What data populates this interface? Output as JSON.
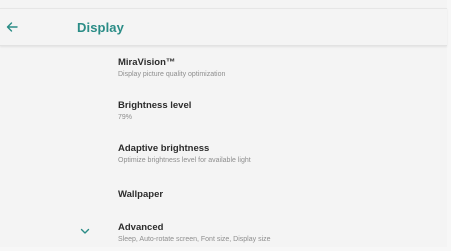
{
  "header": {
    "title": "Display",
    "back_icon": "arrow-left-icon"
  },
  "accent_color": "#2a8c86",
  "settings": [
    {
      "title": "MiraVision™",
      "summary": "Display picture quality optimization"
    },
    {
      "title": "Brightness level",
      "summary": "79%"
    },
    {
      "title": "Adaptive brightness",
      "summary": "Optimize brightness level for available light"
    },
    {
      "title": "Wallpaper",
      "summary": ""
    },
    {
      "title": "Advanced",
      "summary": "Sleep, Auto-rotate screen, Font size, Display size",
      "icon": "chevron-down-icon"
    }
  ]
}
